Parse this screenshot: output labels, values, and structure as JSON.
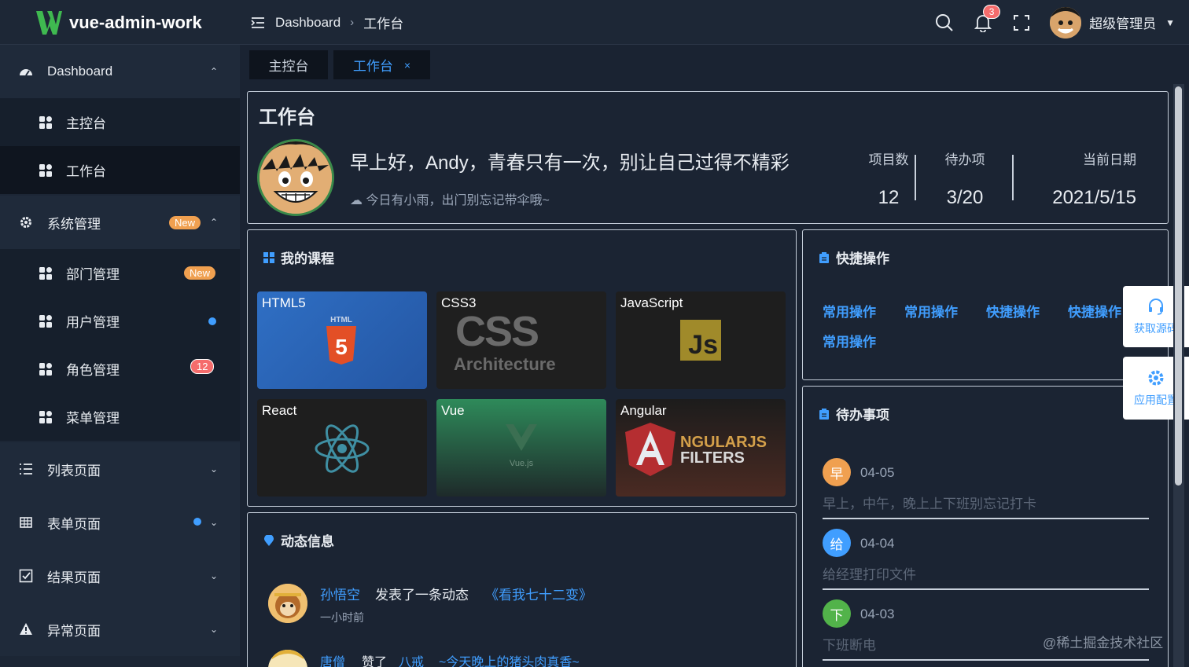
{
  "app": {
    "title": "vue-admin-work"
  },
  "header": {
    "breadcrumb": [
      "Dashboard",
      "工作台"
    ],
    "notification_count": "3",
    "user_name": "超级管理员"
  },
  "sidebar": {
    "groups": [
      {
        "label": "Dashboard",
        "icon": "dashboard-icon"
      },
      {
        "label": "系统管理",
        "icon": "gear-icon",
        "badge": "New"
      },
      {
        "label": "列表页面",
        "icon": "list-icon"
      },
      {
        "label": "表单页面",
        "icon": "table-icon"
      },
      {
        "label": "结果页面",
        "icon": "check-square-icon"
      },
      {
        "label": "异常页面",
        "icon": "warning-icon"
      }
    ],
    "items": [
      {
        "label": "主控台"
      },
      {
        "label": "工作台"
      },
      {
        "label": "部门管理",
        "badge": "New"
      },
      {
        "label": "用户管理"
      },
      {
        "label": "角色管理",
        "badge": "12"
      },
      {
        "label": "菜单管理"
      }
    ]
  },
  "tabs": [
    {
      "label": "主控台",
      "active": false
    },
    {
      "label": "工作台",
      "active": true,
      "close": "×"
    }
  ],
  "workbench": {
    "title": "工作台",
    "greeting": "早上好，Andy，青春只有一次，别让自己过得不精彩",
    "weather": "今日有小雨，出门别忘记带伞哦~",
    "stats": [
      {
        "label": "项目数",
        "value": "12"
      },
      {
        "label": "待办项",
        "value": "3/20"
      },
      {
        "label": "当前日期",
        "value": "2021/5/15"
      }
    ]
  },
  "courses": {
    "title": "我的课程",
    "items": [
      {
        "name": "HTML5",
        "art": "HTML",
        "art2": "5"
      },
      {
        "name": "CSS3",
        "art": "CSS",
        "art2": "Architecture"
      },
      {
        "name": "JavaScript",
        "art": "Js"
      },
      {
        "name": "React"
      },
      {
        "name": "Vue",
        "art": "Vue.js"
      },
      {
        "name": "Angular",
        "art": "NGULARJS",
        "art2": "FILTERS"
      }
    ]
  },
  "quick": {
    "title": "快捷操作",
    "items": [
      "常用操作",
      "常用操作",
      "快捷操作",
      "快捷操作",
      "常用操作"
    ]
  },
  "todos": {
    "title": "待办事项",
    "items": [
      {
        "badge": "早",
        "date": "04-05",
        "text": "早上，中午，晚上上下班别忘记打卡",
        "color": "#f0a050"
      },
      {
        "badge": "给",
        "date": "04-04",
        "text": "给经理打印文件",
        "color": "#409eff"
      },
      {
        "badge": "下",
        "date": "04-03",
        "text": "下班断电",
        "color": "#52b34a"
      }
    ]
  },
  "activity": {
    "title": "动态信息",
    "items": [
      {
        "user": "孙悟空",
        "action": "发表了一条动态",
        "target": "《看我七十二变》",
        "time": "一小时前"
      },
      {
        "user": "唐僧",
        "action": "赞了",
        "target": "八戒",
        "extra": "~今天晚上的猪头肉真香~"
      }
    ]
  },
  "float": {
    "source": "获取源码",
    "config": "应用配置"
  },
  "watermark": "@稀土掘金技术社区"
}
